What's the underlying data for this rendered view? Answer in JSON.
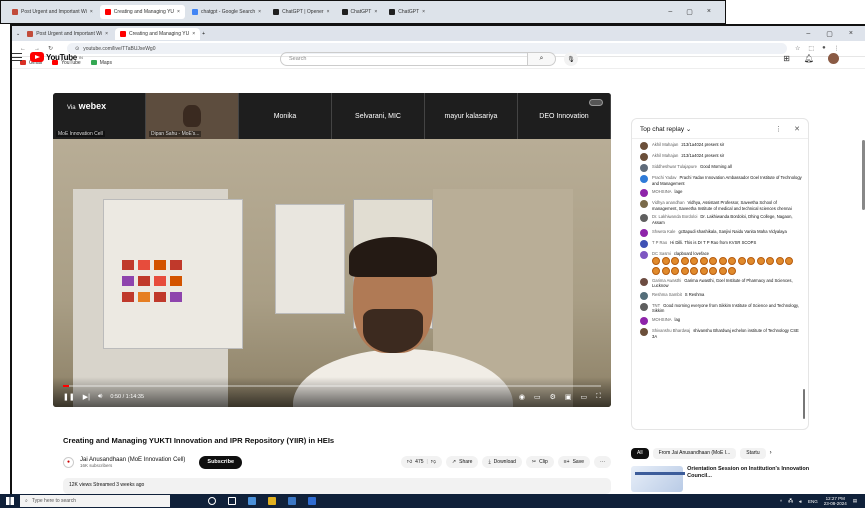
{
  "outer_tabs": [
    {
      "label": "Post Urgent and Important Wi",
      "color": "#c24b3a"
    },
    {
      "label": "Creating and Managing YU",
      "color": "#ff0000",
      "active": true
    },
    {
      "label": "chatgpt - Google Search",
      "color": "#4285f4"
    },
    {
      "label": "ChatGPT | Opener",
      "color": "#202020"
    },
    {
      "label": "ChatGPT",
      "color": "#202020"
    },
    {
      "label": "ChatGPT",
      "color": "#202020"
    }
  ],
  "inner_tabs": [
    {
      "label": "Post Urgent and Important Wi",
      "color": "#c24b3a"
    },
    {
      "label": "Creating and Managing YU",
      "color": "#ff0000",
      "active": true
    }
  ],
  "address": {
    "url": "youtube.com/live/TTaBUJxeWg0"
  },
  "bookmarks": [
    {
      "label": "Gmail",
      "color": "#d93025"
    },
    {
      "label": "YouTube",
      "color": "#ff0000"
    },
    {
      "label": "Maps",
      "color": "#34a853"
    }
  ],
  "youtube": {
    "logo_text": "YouTube",
    "country": "IN",
    "search_placeholder": "Search"
  },
  "player": {
    "webex_label": "webex",
    "webex_via": "Via",
    "participants": [
      {
        "name": "",
        "sub": "MoE Innovation Cell"
      },
      {
        "name": "",
        "sub": "Dipan Sahu - MoE's..."
      },
      {
        "name": "Monika",
        "sub": ""
      },
      {
        "name": "Selvarani, MIC",
        "sub": ""
      },
      {
        "name": "mayur kalasariya",
        "sub": ""
      },
      {
        "name": "DEO Innovation",
        "sub": ""
      }
    ],
    "time": "0:50 / 1:14:35",
    "progress_fraction": 0.011
  },
  "video": {
    "title": "Creating and Managing YUKTI Innovation and IPR Repository (YIIR) in HEIs",
    "channel_name": "Jai Anusandhaan (MoE Innovation Cell)",
    "subscribers": "16K subscribers",
    "subscribe_label": "Subscribe",
    "likes": "475",
    "share_label": "Share",
    "download_label": "Download",
    "clip_label": "Clip",
    "save_label": "Save",
    "more_label": "···",
    "meta": "12K views  Streamed 3 weeks ago"
  },
  "chat": {
    "header": "Top chat replay",
    "messages": [
      {
        "author": "Akhil Mahajan",
        "text": "213/1a4024 present sir",
        "color": "#6b4f3a"
      },
      {
        "author": "Akhil Mahajan",
        "text": "213/1a4024 present sir",
        "color": "#6b4f3a"
      },
      {
        "author": "Siddheshwar Tulajapure",
        "text": "Good Morning all",
        "color": "#5f6b7a"
      },
      {
        "author": "Prachi Yadav",
        "text": "Prachi Yadav Innovation Ambassador Goel Institute of Technology and Management",
        "color": "#2f7bd8"
      },
      {
        "author": "MOHSINA",
        "text": "lage",
        "color": "#8e24aa"
      },
      {
        "author": "Vidhya anandhan",
        "text": "Vidhya, Assistant Professor, Saveetha School of management, Saveetha Institute of medical and technical sciences chennai",
        "color": "#7a6a4a"
      },
      {
        "author": "Dr. Lakhiwanda Bordoloi",
        "text": "Dr. Lakhiwanda Bordoloi, Dhing College, Nagaon, Assam",
        "color": "#5f5f5f"
      },
      {
        "author": "Shweta Kale",
        "text": "gcttapudi shashikala, Sanjivi Naidu Vanita Maha Vidyalaya",
        "color": "#8e24aa"
      },
      {
        "author": "T P Rao",
        "text": "Hi Dilli. This is Dr T P Rao from KVSR SCOPS",
        "color": "#3f51b5"
      },
      {
        "author": "DC Sasmi",
        "text": "clapboard loveface",
        "color": "#7e57c2",
        "emojis": 24
      },
      {
        "author": "Garima Awasthi",
        "text": "Garima Awasthi, Goel Institute of Pharmacy and Sciences, Lucknow",
        "color": "#6d4c41"
      },
      {
        "author": "Reshma Sambit",
        "text": "S Reshma",
        "color": "#546e7a"
      },
      {
        "author": "TNT",
        "text": "Good morning everyone from Sikkim Institute of Science and Technology, Sikkim",
        "color": "#5f5f5f"
      },
      {
        "author": "MOHSINA",
        "text": "lag",
        "color": "#8e24aa"
      },
      {
        "author": "Shivanshu Bhardwaj",
        "text": "shivanshu Bhardwaj echelon institute of Technology CSE 3A",
        "color": "#6b4f3a"
      }
    ]
  },
  "related": {
    "chips": [
      "All",
      "From Jai Anusandhaan (MoE I...",
      "Startu"
    ],
    "item_title": "Orientation Session on Institution's Innovation Council..."
  },
  "taskbar": {
    "search_placeholder": "Type here to search",
    "lang": "ENG",
    "time": "12:27 PM",
    "date": "23-08-2024"
  }
}
